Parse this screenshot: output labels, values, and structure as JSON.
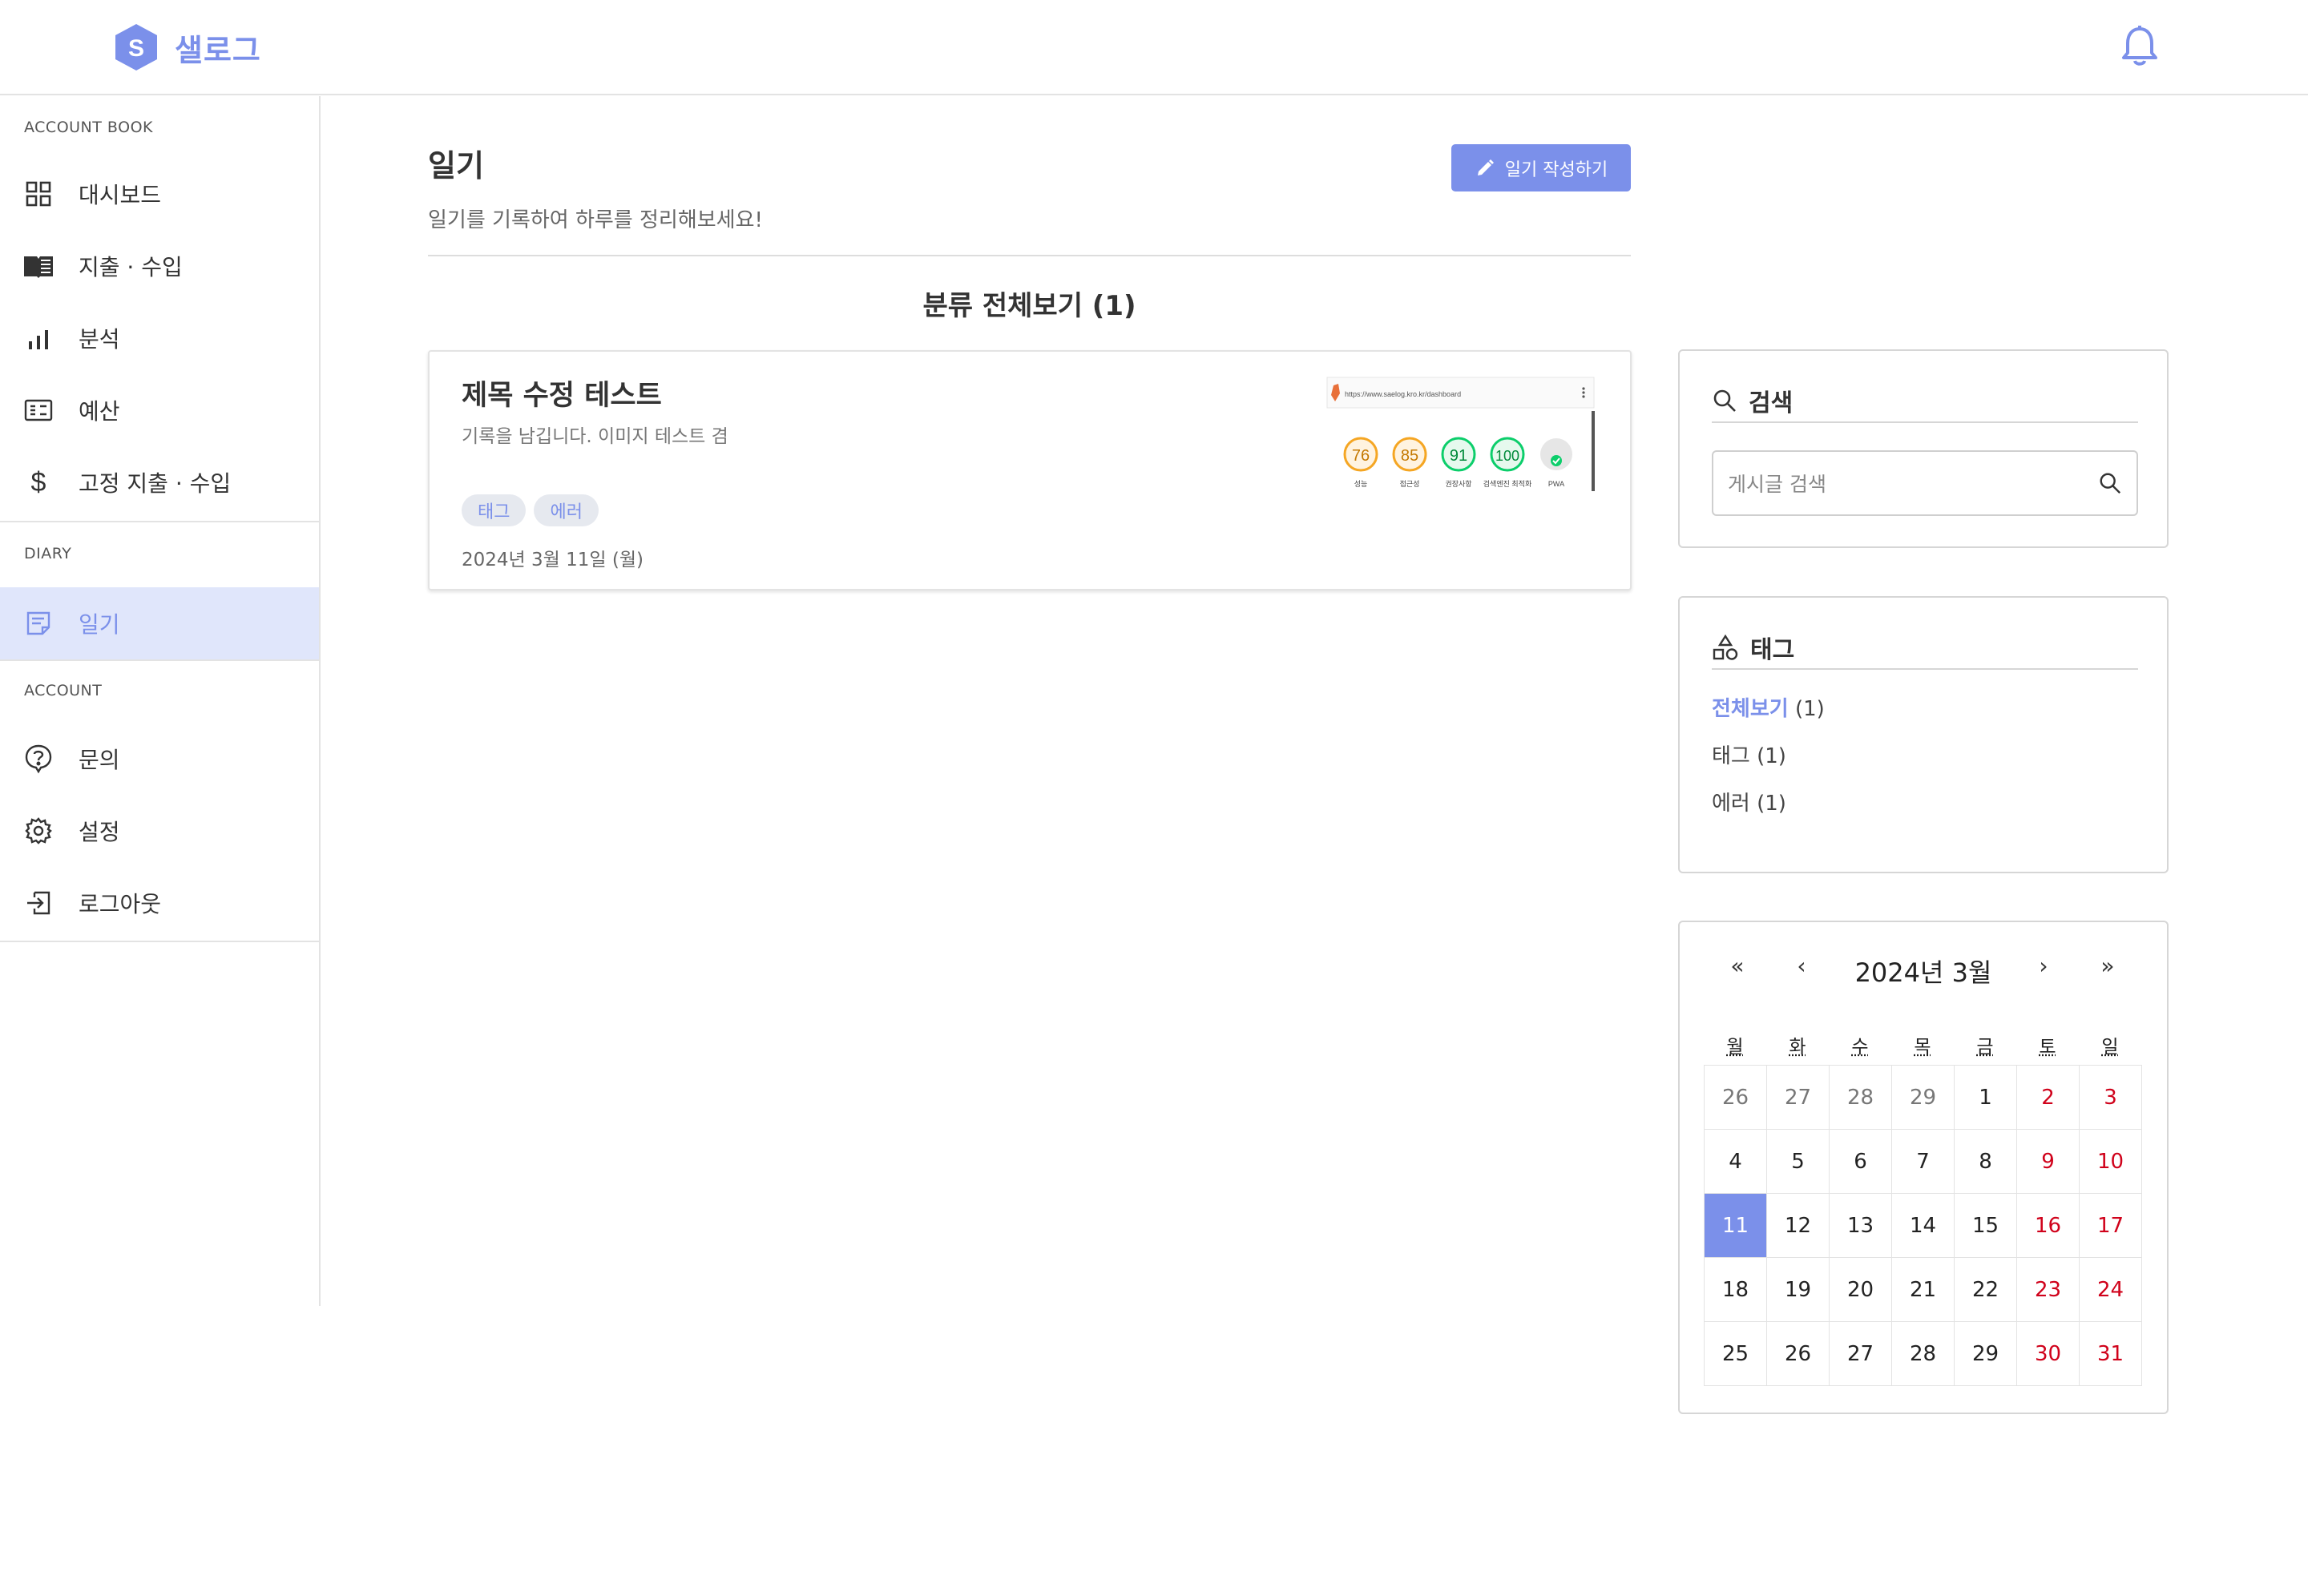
{
  "brand": {
    "name": "샐로그",
    "mark_letter": "S"
  },
  "sidebar": {
    "sections": [
      {
        "label": "ACCOUNT BOOK"
      },
      {
        "label": "DIARY"
      },
      {
        "label": "ACCOUNT"
      }
    ],
    "items": [
      {
        "label": "대시보드",
        "icon": "grid-icon"
      },
      {
        "label": "지출 · 수입",
        "icon": "book-icon"
      },
      {
        "label": "분석",
        "icon": "bar-chart-icon"
      },
      {
        "label": "예산",
        "icon": "budget-icon"
      },
      {
        "label": "고정 지출 · 수입",
        "icon": "dollar-icon"
      },
      {
        "label": "일기",
        "icon": "note-icon",
        "active": true
      },
      {
        "label": "문의",
        "icon": "question-icon"
      },
      {
        "label": "설정",
        "icon": "gear-icon"
      },
      {
        "label": "로그아웃",
        "icon": "logout-icon"
      }
    ]
  },
  "main": {
    "title": "일기",
    "subtitle": "일기를 기록하여 하루를 정리해보세요!",
    "write_button": "일기 작성하기",
    "category_title": "분류 전체보기 (1)",
    "posts": [
      {
        "title": "제목 수정 테스트",
        "excerpt": "기록을 남깁니다. 이미지 테스트 겸",
        "tags": [
          "태그",
          "에러"
        ],
        "date": "2024년 3월 11일 (월)",
        "thumbnail": {
          "url": "https://www.saelog.kro.kr/dashboard",
          "scores": [
            {
              "value": "76",
              "label": "성능",
              "color": "#f5a623"
            },
            {
              "value": "85",
              "label": "접근성",
              "color": "#f5a623"
            },
            {
              "value": "91",
              "label": "권장사항",
              "color": "#0cce6b"
            },
            {
              "value": "100",
              "label": "검색엔진 최적화",
              "color": "#0cce6b"
            },
            {
              "value": "PWA",
              "label": "PWA",
              "color": "#0cce6b"
            }
          ]
        }
      }
    ]
  },
  "search": {
    "title": "검색",
    "placeholder": "게시글 검색"
  },
  "tags_panel": {
    "title": "태그",
    "items": [
      {
        "name": "전체보기",
        "count": "(1)",
        "selected": true
      },
      {
        "name": "태그",
        "count": "(1)",
        "selected": false
      },
      {
        "name": "에러",
        "count": "(1)",
        "selected": false
      }
    ]
  },
  "calendar": {
    "title": "2024년 3월",
    "nav": {
      "prev_year": "«",
      "prev_month": "‹",
      "next_month": "›",
      "next_year": "»"
    },
    "weekdays": [
      "월",
      "화",
      "수",
      "목",
      "금",
      "토",
      "일"
    ],
    "weeks": [
      [
        "26",
        "27",
        "28",
        "29",
        "1",
        "2",
        "3"
      ],
      [
        "4",
        "5",
        "6",
        "7",
        "8",
        "9",
        "10"
      ],
      [
        "11",
        "12",
        "13",
        "14",
        "15",
        "16",
        "17"
      ],
      [
        "18",
        "19",
        "20",
        "21",
        "22",
        "23",
        "24"
      ],
      [
        "25",
        "26",
        "27",
        "28",
        "29",
        "30",
        "31"
      ]
    ],
    "other_month_cells": 4,
    "selected_day": "11",
    "weekend_color": "#d0021b",
    "accent_color": "#7b90ea"
  }
}
